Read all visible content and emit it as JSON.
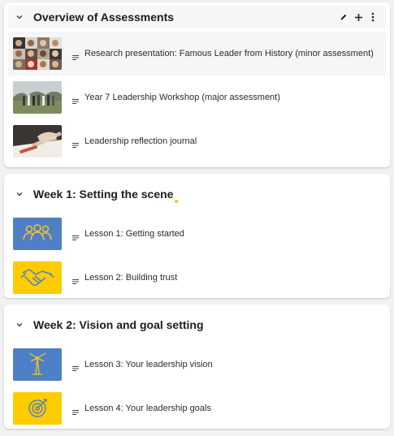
{
  "sections": [
    {
      "title": "Overview of Assessments",
      "activities": [
        {
          "label": "Research presentation: Famous Leader from History (minor assessment)",
          "thumbnail": "collage-of-historical-leaders-photo"
        },
        {
          "label": "Year 7 Leadership Workshop (major assessment)",
          "thumbnail": "group-of-students-outdoors-photo"
        },
        {
          "label": "Leadership reflection journal",
          "thumbnail": "hand-writing-in-journal-photo"
        }
      ]
    },
    {
      "title": "Week 1: Setting the scene",
      "activities": [
        {
          "label": "Lesson 1: Getting started",
          "thumbnail": "group-people-icon"
        },
        {
          "label": "Lesson 2: Building trust",
          "thumbnail": "handshake-icon"
        }
      ]
    },
    {
      "title": "Week 2: Vision and goal setting",
      "activities": [
        {
          "label": "Lesson 3: Your leadership vision",
          "thumbnail": "lighthouse-icon"
        },
        {
          "label": "Lesson 4: Your leadership goals",
          "thumbnail": "target-icon"
        }
      ]
    }
  ],
  "colors": {
    "accent_blue": "#4f7fc6",
    "accent_yellow": "#ffcc00",
    "icon_yellow": "#f5c518",
    "icon_blue": "#4f7fc6"
  }
}
